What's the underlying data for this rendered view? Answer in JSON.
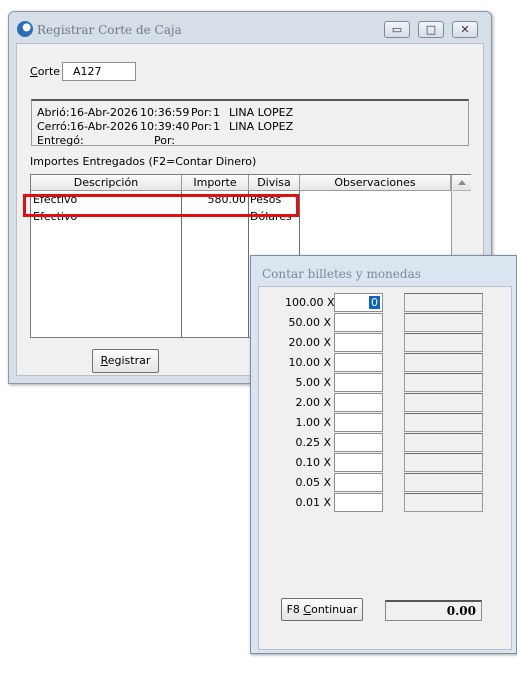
{
  "main_window": {
    "title": "Registrar Corte de Caja",
    "caption_buttons": {
      "minimize": "▭",
      "maximize": "□",
      "close": "✕"
    },
    "corte": {
      "label_initial": "C",
      "label_rest": "orte",
      "value": "A127"
    },
    "info": {
      "abrio_label": "Abrió:",
      "abrio_fecha": "16-Abr-2026",
      "abrio_hora": "10:36:59",
      "abrio_por_label": "Por:",
      "abrio_por_num": "1",
      "abrio_usuario": "LINA LOPEZ",
      "cerro_label": "Cerró:",
      "cerro_fecha": "16-Abr-2026",
      "cerro_hora": "10:39:40",
      "cerro_por_label": "Por:",
      "cerro_por_num": "1",
      "cerro_usuario": "LINA LOPEZ",
      "entrego_label": "Entregó:",
      "entrego_por_label": "Por:"
    },
    "importes_heading": "Importes Entregados (F2=Contar Dinero)",
    "columns": {
      "descripcion": "Descripción",
      "importe": "Importe",
      "divisa": "Divisa",
      "observaciones": "Observaciones"
    },
    "rows": [
      {
        "descripcion": "Efectivo",
        "importe": "580.00",
        "divisa": "Pesos",
        "observaciones": ""
      },
      {
        "descripcion": "Efectivo",
        "importe": "",
        "divisa": "Dólares",
        "observaciones": ""
      }
    ],
    "registrar_button": {
      "initial": "R",
      "rest": "egistrar"
    }
  },
  "count_dialog": {
    "title": "Contar billetes y monedas",
    "denominations": [
      {
        "label": "100.00 X",
        "quantity": "0"
      },
      {
        "label": "50.00 X",
        "quantity": ""
      },
      {
        "label": "20.00 X",
        "quantity": ""
      },
      {
        "label": "10.00 X",
        "quantity": ""
      },
      {
        "label": "5.00 X",
        "quantity": ""
      },
      {
        "label": "2.00 X",
        "quantity": ""
      },
      {
        "label": "1.00 X",
        "quantity": ""
      },
      {
        "label": "0.25 X",
        "quantity": ""
      },
      {
        "label": "0.10 X",
        "quantity": ""
      },
      {
        "label": "0.05 X",
        "quantity": ""
      },
      {
        "label": "0.01 X",
        "quantity": ""
      }
    ],
    "continue_button": {
      "prefix": "F8 ",
      "initial": "C",
      "rest": "ontinuar"
    },
    "total": "0.00"
  },
  "colors": {
    "highlight": "#e01010",
    "selection": "#0a64c8"
  },
  "icons": [
    "app-icon",
    "scroll-up-arrow-icon"
  ]
}
